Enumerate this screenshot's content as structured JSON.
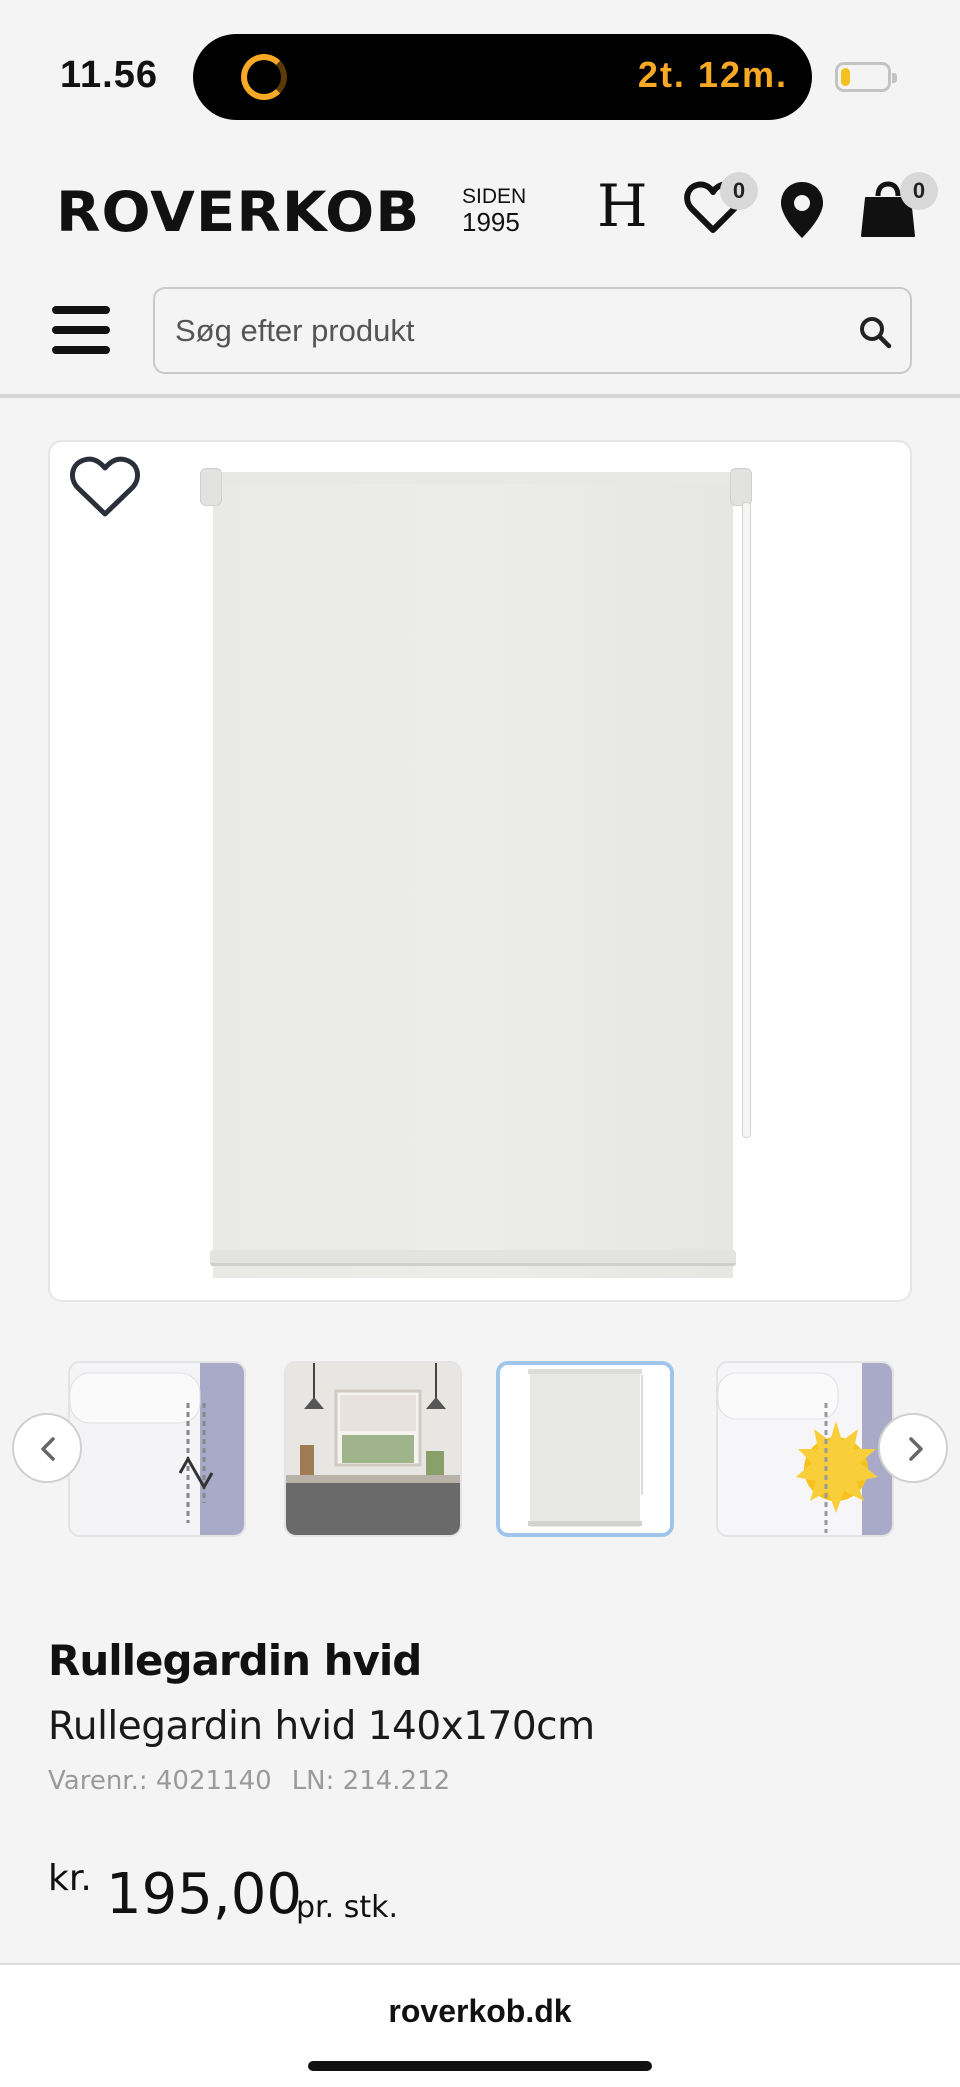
{
  "status_bar": {
    "time": "11.56",
    "timer": "2t. 12m.",
    "battery_level": 0.3,
    "accent": "#f7a825"
  },
  "header": {
    "logo": "ROVERKOB",
    "logo_siden": "SIDEN",
    "logo_year": "1995",
    "h_icon_label": "H",
    "wishlist_count": "0",
    "cart_count": "0"
  },
  "search": {
    "placeholder": "Søg efter produkt"
  },
  "icons": [
    "menu-icon",
    "search-icon",
    "heart-icon",
    "location-pin-icon",
    "shopping-bag-icon",
    "chevron-left-icon",
    "chevron-right-icon"
  ],
  "gallery": {
    "thumbnails": [
      "blind-mechanism-detail",
      "kitchen-window-with-blind",
      "white-roller-blind",
      "blind-sun-detail"
    ],
    "active_index": 2,
    "active_border_color": "#9fc6ea"
  },
  "product": {
    "title": "Rullegardin hvid",
    "subtitle": "Rullegardin hvid 140x170cm",
    "item_number": "Varenr.: 4021140",
    "ln_number": "LN: 214.212",
    "currency": "kr.",
    "price": "195,00",
    "unit": "pr. stk."
  },
  "browser": {
    "url": "roverkob.dk"
  }
}
